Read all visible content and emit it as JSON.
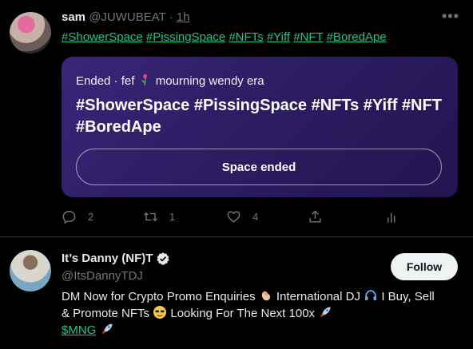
{
  "tweet": {
    "author_name": "sam",
    "author_handle": "@JUWUBEAT",
    "separator": "·",
    "time": "1h",
    "more_label": "•••",
    "hashtags": [
      "#ShowerSpace",
      "#PissingSpace",
      "#NFTs",
      "#Yiff",
      "#NFT",
      "#BoredApe"
    ],
    "space": {
      "status": "Ended · fef",
      "host_tail": "mourning wendy era",
      "title": "#ShowerSpace #PissingSpace #NFTs #Yiff #NFT #BoredApe",
      "button_label": "Space ended"
    },
    "actions": {
      "reply_count": "2",
      "retweet_count": "1",
      "like_count": "4"
    }
  },
  "user_card": {
    "name": "It’s Danny (NF)T",
    "handle": "@ItsDannyTDJ",
    "follow_label": "Follow",
    "bio": {
      "part1": "DM Now for Crypto Promo Enquiries",
      "part2": "International DJ",
      "part3": "I Buy, Sell & Promote NFTs",
      "part4": "Looking For The Next 100x",
      "cashtag": "$MNG"
    }
  },
  "colors": {
    "background": "#000000",
    "link": "#1dc48f",
    "muted": "#71767b",
    "space_card": "#2d1d63",
    "follow_bg": "#eff3f4",
    "verified": "#e7e9ea"
  }
}
